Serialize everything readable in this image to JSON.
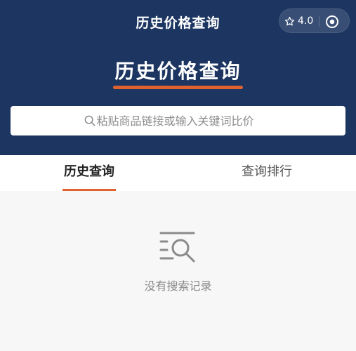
{
  "app": {
    "nav_title": "历史价格查询",
    "rating": "4.0"
  },
  "hero": {
    "title": "历史价格查询"
  },
  "search": {
    "placeholder": "粘贴商品链接或输入关键词比价",
    "value": ""
  },
  "tabs": [
    {
      "label": "历史查询",
      "active": true
    },
    {
      "label": "查询排行",
      "active": false
    }
  ],
  "empty_state": {
    "icon": "search-list-icon",
    "text": "没有搜索记录"
  },
  "colors": {
    "header_bg": "#1d3661",
    "accent": "#e0622f",
    "page_bg": "#f7f7f7"
  }
}
